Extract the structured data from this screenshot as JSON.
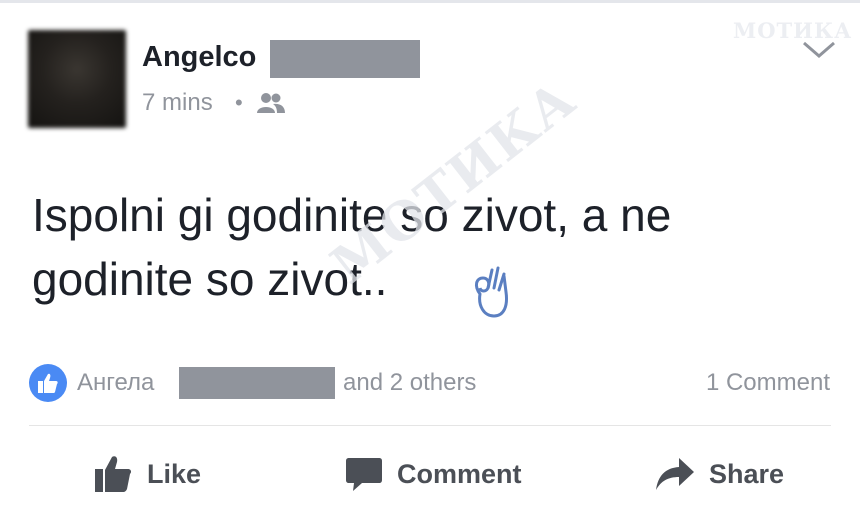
{
  "watermark": "МОТИКА",
  "post": {
    "author_name": "Angelco",
    "timestamp": "7 mins",
    "separator": "•",
    "audience_icon": "friends-icon",
    "text": "Ispolni gi godinite so zivot, a ne godinite so zivot..",
    "emoji": "ok-hand-icon"
  },
  "reactions": {
    "liker_name": "Ангела",
    "others_text": "and 2 others",
    "comment_count": "1 Comment"
  },
  "actions": {
    "like_label": "Like",
    "comment_label": "Comment",
    "share_label": "Share"
  },
  "colors": {
    "accent": "#4a8af4",
    "muted_text": "#90949c",
    "action_text": "#4b4f56",
    "redaction": "#90949c"
  }
}
